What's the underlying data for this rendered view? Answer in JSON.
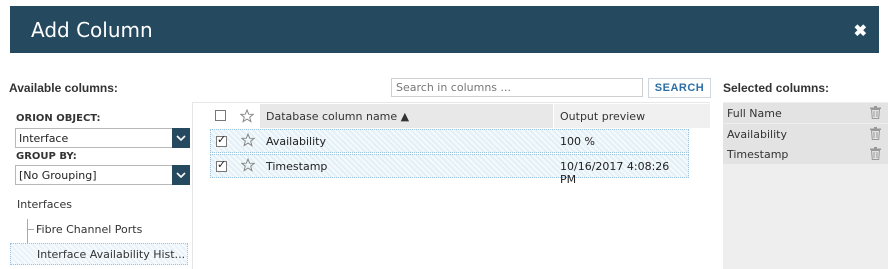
{
  "dialog": {
    "title": "Add Column",
    "close_glyph": "✖"
  },
  "available": {
    "label": "Available columns:",
    "search": {
      "placeholder": "Search in columns ...",
      "value": "",
      "button": "SEARCH"
    }
  },
  "filters": {
    "orion_object": {
      "label": "ORION OBJECT:",
      "value": "Interface"
    },
    "group_by": {
      "label": "GROUP BY:",
      "value": "[No Grouping]"
    }
  },
  "tree": {
    "root": "Interfaces",
    "items": [
      {
        "label": "Fibre Channel Ports",
        "selected": false
      },
      {
        "label": "Interface Availability Hist...",
        "selected": true
      }
    ]
  },
  "grid": {
    "headers": {
      "name": "Database column name ▲",
      "preview": "Output preview"
    },
    "rows": [
      {
        "checked": true,
        "name": "Availability",
        "preview": "100 %"
      },
      {
        "checked": true,
        "name": "Timestamp",
        "preview": "10/16/2017 4:08:26 PM"
      }
    ]
  },
  "selected": {
    "label": "Selected columns:",
    "items": [
      "Full Name",
      "Availability",
      "Timestamp"
    ]
  },
  "colors": {
    "header_bg": "#25495f",
    "accent_blue": "#2b6fa6",
    "row_highlight": "#e4f0f8"
  },
  "icons": [
    "close-icon",
    "chevron-down-icon",
    "star-icon",
    "trash-icon",
    "checkbox-icon"
  ]
}
